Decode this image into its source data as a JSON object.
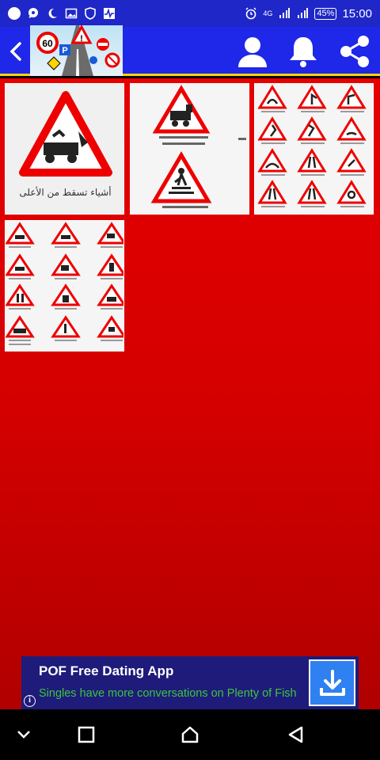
{
  "status_bar": {
    "time": "15:00",
    "battery": "45",
    "network": "4G",
    "icons": [
      "notification-icon",
      "chat-icon",
      "night-icon",
      "image-icon",
      "shield-icon",
      "activity-icon",
      "alarm-icon",
      "signal-icon",
      "signal-icon",
      "battery-icon"
    ]
  },
  "app_bar": {
    "logo_speed_value": "60",
    "logo_parking_letter": "P",
    "actions": [
      "profile-icon",
      "bell-icon",
      "share-icon"
    ]
  },
  "colors": {
    "status_bar": "#1f27c8",
    "app_bar": "#1f27e8",
    "accent_line": "#ffd400",
    "background": "#e60000",
    "ad_background": "#1e1b7a",
    "ad_text": "#3cc63c",
    "download_button": "#2f80f0"
  },
  "gallery": {
    "items": [
      {
        "name": "gallery-item-1",
        "caption": "أشياء تسقط من الأعلى"
      },
      {
        "name": "gallery-item-2",
        "caption": ""
      },
      {
        "name": "gallery-item-3",
        "caption": ""
      },
      {
        "name": "gallery-item-4",
        "caption": ""
      }
    ]
  },
  "ad": {
    "title": "POF Free Dating App",
    "body": "Singles have more conversations on Plenty of Fish",
    "info": "i"
  },
  "nav_bar": {
    "buttons": [
      "chevron-down-icon",
      "recents-icon",
      "home-icon",
      "back-icon"
    ]
  }
}
